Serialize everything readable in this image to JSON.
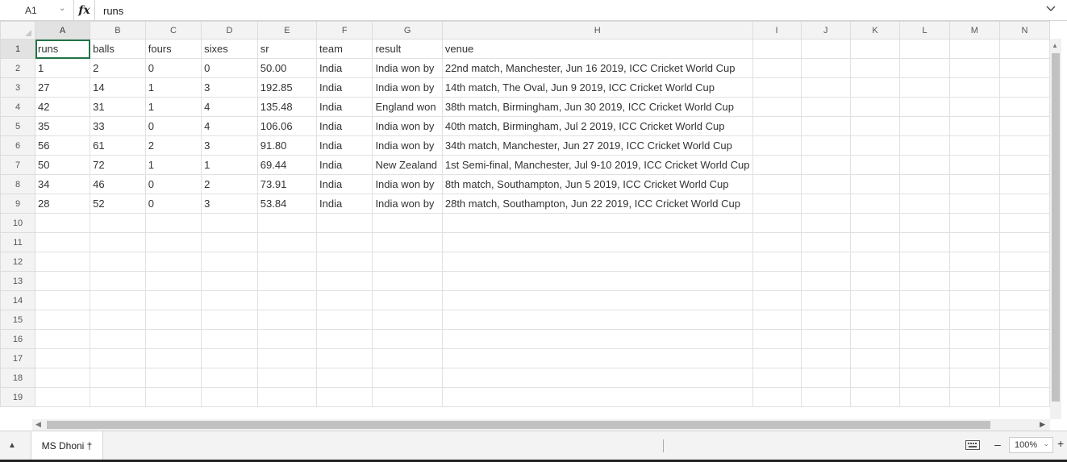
{
  "formula_bar": {
    "cell_ref": "A1",
    "fx_label": "fx",
    "content": "runs"
  },
  "columns": [
    "A",
    "B",
    "C",
    "D",
    "E",
    "F",
    "G",
    "H",
    "I",
    "J",
    "K",
    "L",
    "M",
    "N"
  ],
  "row_numbers": [
    "1",
    "2",
    "3",
    "4",
    "5",
    "6",
    "7",
    "8",
    "9",
    "10",
    "11",
    "12",
    "13",
    "14",
    "15",
    "16",
    "17",
    "18",
    "19"
  ],
  "rows": [
    [
      "runs",
      "balls",
      "fours",
      "sixes",
      "sr",
      "team",
      "result",
      "venue"
    ],
    [
      "1",
      "2",
      "0",
      "0",
      "50.00",
      "India",
      "India won by",
      "22nd match, Manchester, Jun 16 2019, ICC Cricket World Cup"
    ],
    [
      "27",
      "14",
      "1",
      "3",
      "192.85",
      "India",
      "India won by",
      "14th match, The Oval, Jun 9 2019, ICC Cricket World Cup"
    ],
    [
      "42",
      "31",
      "1",
      "4",
      "135.48",
      "India",
      "England won",
      "38th match, Birmingham, Jun 30 2019, ICC Cricket World Cup"
    ],
    [
      "35",
      "33",
      "0",
      "4",
      "106.06",
      "India",
      "India won by",
      "40th match, Birmingham, Jul 2 2019, ICC Cricket World Cup"
    ],
    [
      "56",
      "61",
      "2",
      "3",
      "91.80",
      "India",
      "India won by",
      "34th match, Manchester, Jun 27 2019, ICC Cricket World Cup"
    ],
    [
      "50",
      "72",
      "1",
      "1",
      "69.44",
      "India",
      "New Zealand",
      "1st Semi-final, Manchester, Jul 9-10 2019, ICC Cricket World Cup"
    ],
    [
      "34",
      "46",
      "0",
      "2",
      "73.91",
      "India",
      "India won by",
      "8th match, Southampton, Jun 5 2019, ICC Cricket World Cup"
    ],
    [
      "28",
      "52",
      "0",
      "3",
      "53.84",
      "India",
      "India won by",
      "28th match, Southampton, Jun 22 2019, ICC Cricket World Cup"
    ]
  ],
  "sheet_tab": "MS Dhoni †",
  "zoom": "100%",
  "icons": {
    "namebox_dropdown": "chevron-down-icon",
    "formula_expand": "chevron-down-icon",
    "sheet_list": "triangle-up-icon",
    "keyboard": "keyboard-icon",
    "zoom_out": "minus-icon",
    "zoom_in": "plus-icon"
  },
  "colors": {
    "selection": "#217346",
    "header_bg": "#f3f3f3"
  }
}
